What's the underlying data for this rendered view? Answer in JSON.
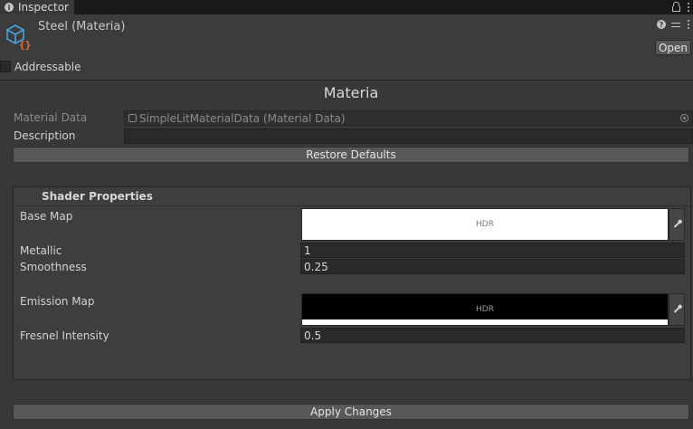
{
  "tab": {
    "title": "Inspector",
    "info_glyph": "i"
  },
  "header": {
    "asset_title": "Steel (Materia)",
    "help_glyph": "?",
    "open_label": "Open",
    "addressable_label": "Addressable",
    "addressable_checked": false
  },
  "main": {
    "title": "Materia",
    "material_data_label": "Material Data",
    "material_data_value": "SimpleLitMaterialData (Material Data)",
    "description_label": "Description",
    "description_value": "",
    "restore_label": "Restore Defaults"
  },
  "shader": {
    "title": "Shader Properties",
    "base_map_label": "Base Map",
    "base_map_hdr": "HDR",
    "base_map_color": "#ffffff",
    "metallic_label": "Metallic",
    "metallic_value": "1",
    "smoothness_label": "Smoothness",
    "smoothness_value": "0.25",
    "emission_map_label": "Emission Map",
    "emission_map_hdr": "HDR",
    "emission_map_color": "#000000",
    "fresnel_label": "Fresnel Intensity",
    "fresnel_value": "0.5"
  },
  "footer": {
    "apply_label": "Apply Changes"
  },
  "colors": {
    "background": "#383838",
    "accent_orange": "#e8743b",
    "accent_blue": "#4aa3df"
  }
}
